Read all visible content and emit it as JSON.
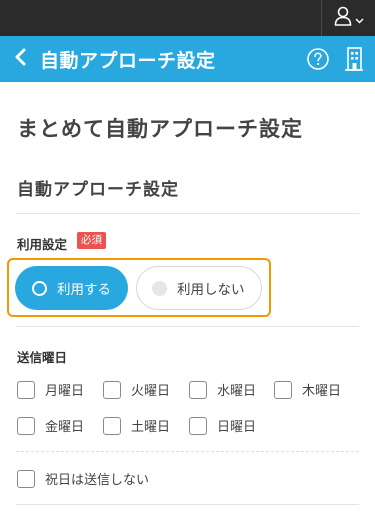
{
  "header": {
    "title": "自動アプローチ設定",
    "icons": {
      "back": "chevron-left-icon",
      "help": "question-circle-icon",
      "org": "building-icon",
      "user": "user-icon",
      "menu": "chevron-down-icon"
    }
  },
  "page": {
    "heading": "まとめて自動アプローチ設定",
    "section_heading": "自動アプローチ設定"
  },
  "usage_setting": {
    "label": "利用設定",
    "required_badge": "必須",
    "options": [
      {
        "label": "利用する",
        "selected": true
      },
      {
        "label": "利用しない",
        "selected": false
      }
    ]
  },
  "send_days": {
    "label": "送信曜日",
    "days": [
      {
        "label": "月曜日",
        "checked": false
      },
      {
        "label": "火曜日",
        "checked": false
      },
      {
        "label": "水曜日",
        "checked": false
      },
      {
        "label": "木曜日",
        "checked": false
      },
      {
        "label": "金曜日",
        "checked": false
      },
      {
        "label": "土曜日",
        "checked": false
      },
      {
        "label": "日曜日",
        "checked": false
      }
    ],
    "holiday_option": {
      "label": "祝日は送信しない",
      "checked": false
    }
  },
  "colors": {
    "accent": "#29a8e0",
    "highlight": "#f39800",
    "required": "#e8544f",
    "topbar": "#2b2b2b"
  }
}
